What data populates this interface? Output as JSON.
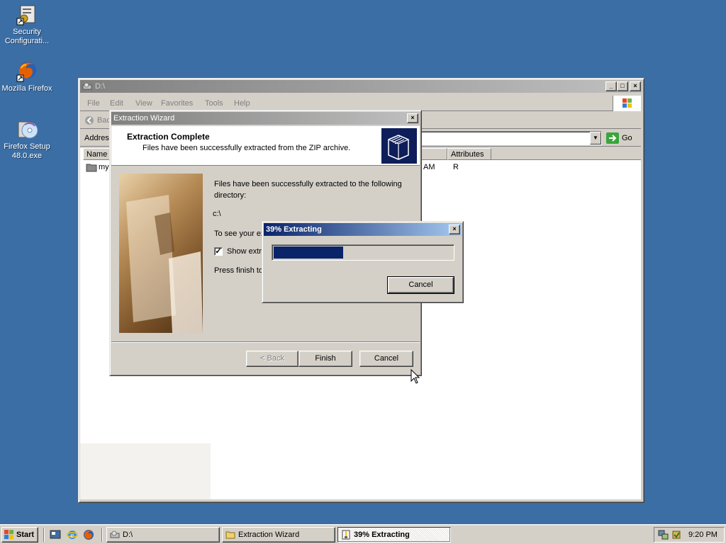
{
  "desktop": {
    "icons": [
      {
        "label": "Security Configurati...",
        "icon": "security-config-icon"
      },
      {
        "label": "Mozilla Firefox",
        "icon": "firefox-icon"
      },
      {
        "label": "Firefox Setup 48.0.exe",
        "icon": "installer-cd-icon"
      }
    ]
  },
  "explorer": {
    "title": "D:\\",
    "menu": [
      "File",
      "Edit",
      "View",
      "Favorites",
      "Tools",
      "Help"
    ],
    "back_label": "Bac",
    "address_label": "Addres",
    "go_label": "Go",
    "columns": {
      "name": "Name",
      "attributes": "Attributes"
    },
    "row": {
      "name": "myp",
      "time_tail": "AM",
      "attributes": "R"
    }
  },
  "wizard": {
    "title": "Extraction Wizard",
    "heading": "Extraction Complete",
    "subheading": "Files have been successfully extracted from the ZIP archive.",
    "body_line1": "Files have been successfully extracted to the following",
    "body_line2": "directory:",
    "directory": "c:\\",
    "see_text": "To see your ex",
    "show_checkbox_label": "Show extr",
    "show_checked": true,
    "press_text": "Press finish to",
    "back_btn": "< Back",
    "finish_btn": "Finish",
    "cancel_btn": "Cancel"
  },
  "progress": {
    "title": "39% Extracting",
    "percent": 39,
    "cancel_btn": "Cancel"
  },
  "taskbar": {
    "start": "Start",
    "tasks": [
      {
        "label": "D:\\",
        "icon": "drive-icon"
      },
      {
        "label": "Extraction Wizard",
        "icon": "folder-icon"
      },
      {
        "label": "39% Extracting",
        "icon": "zip-icon"
      }
    ],
    "clock": "9:20 PM"
  },
  "colors": {
    "desktop": "#3a6ea5",
    "titlebar_active": "#0a246a",
    "progress_fill": "#0a246a"
  }
}
